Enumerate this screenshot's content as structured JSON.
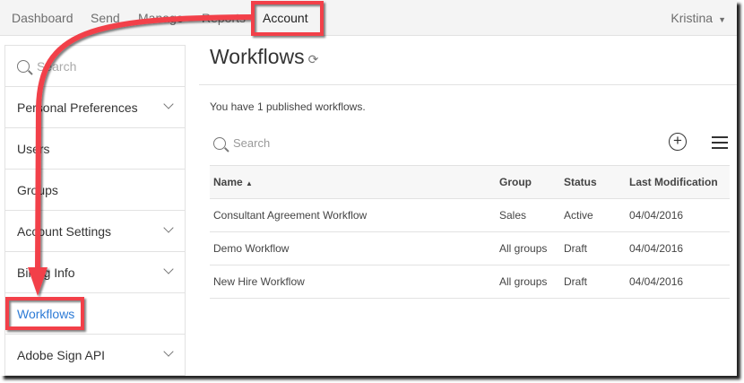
{
  "topnav": {
    "items": [
      "Dashboard",
      "Send",
      "Manage",
      "Reports",
      "Account"
    ],
    "active": "Account",
    "user": "Kristina"
  },
  "sidebar": {
    "search_placeholder": "Search",
    "items": [
      {
        "label": "Personal Preferences",
        "expandable": true
      },
      {
        "label": "Users",
        "expandable": false
      },
      {
        "label": "Groups",
        "expandable": false
      },
      {
        "label": "Account Settings",
        "expandable": true
      },
      {
        "label": "Billing Info",
        "expandable": true
      },
      {
        "label": "Workflows",
        "expandable": false,
        "active": true
      },
      {
        "label": "Adobe Sign API",
        "expandable": true
      }
    ]
  },
  "main": {
    "title": "Workflows",
    "published_text": "You have 1 published workflows.",
    "search_placeholder": "Search",
    "columns": [
      "Name",
      "Group",
      "Status",
      "Last Modification"
    ],
    "rows": [
      [
        "Consultant Agreement Workflow",
        "Sales",
        "Active",
        "04/04/2016"
      ],
      [
        "Demo Workflow",
        "All groups",
        "Draft",
        "04/04/2016"
      ],
      [
        "New Hire Workflow",
        "All groups",
        "Draft",
        "04/04/2016"
      ]
    ]
  },
  "annotation_color": "#f2404a",
  "link_color": "#2d7bd6"
}
